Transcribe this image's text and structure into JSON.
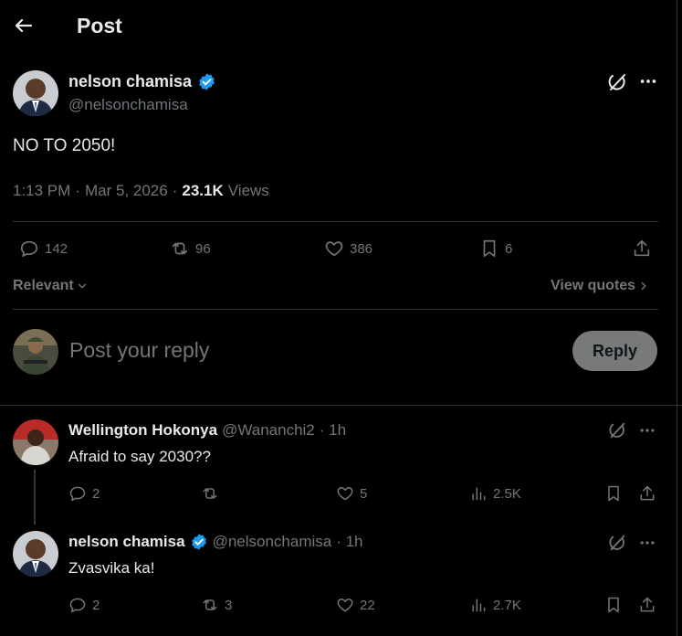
{
  "header": {
    "title": "Post"
  },
  "post": {
    "author_name": "nelson chamisa",
    "author_handle": "@nelsonchamisa",
    "text": "NO TO 2050!",
    "time": "1:13 PM",
    "date": "Mar 5, 2026",
    "separator": "·",
    "views_count": "23.1K",
    "views_label": "Views",
    "stats": {
      "replies": "142",
      "reposts": "96",
      "likes": "386",
      "bookmarks": "6"
    }
  },
  "sort": {
    "label": "Relevant",
    "view_quotes": "View quotes"
  },
  "composer": {
    "placeholder": "Post your reply",
    "reply_button": "Reply"
  },
  "replies": [
    {
      "author_name": "Wellington Hokonya",
      "author_handle": "@Wananchi2",
      "time": "· 1h",
      "text": "Afraid to say 2030??",
      "stats": {
        "replies": "2",
        "reposts": "",
        "likes": "5",
        "views": "2.5K"
      }
    },
    {
      "author_name": "nelson chamisa",
      "author_handle": "@nelsonchamisa",
      "time": "· 1h",
      "text": "Zvasvika ka!",
      "stats": {
        "replies": "2",
        "reposts": "3",
        "likes": "22",
        "views": "2.7K"
      }
    }
  ],
  "colors": {
    "background": "#000000",
    "verified": "#1d9bf0",
    "muted": "#71767b",
    "divider": "#2f3336",
    "reply_button": "#787a7a"
  },
  "icons": [
    "back-arrow-icon",
    "grok-icon",
    "more-icon",
    "reply-icon",
    "repost-icon",
    "like-icon",
    "bookmark-icon",
    "share-icon",
    "views-icon",
    "verified-badge-icon",
    "chevron-down-icon",
    "chevron-right-icon"
  ]
}
